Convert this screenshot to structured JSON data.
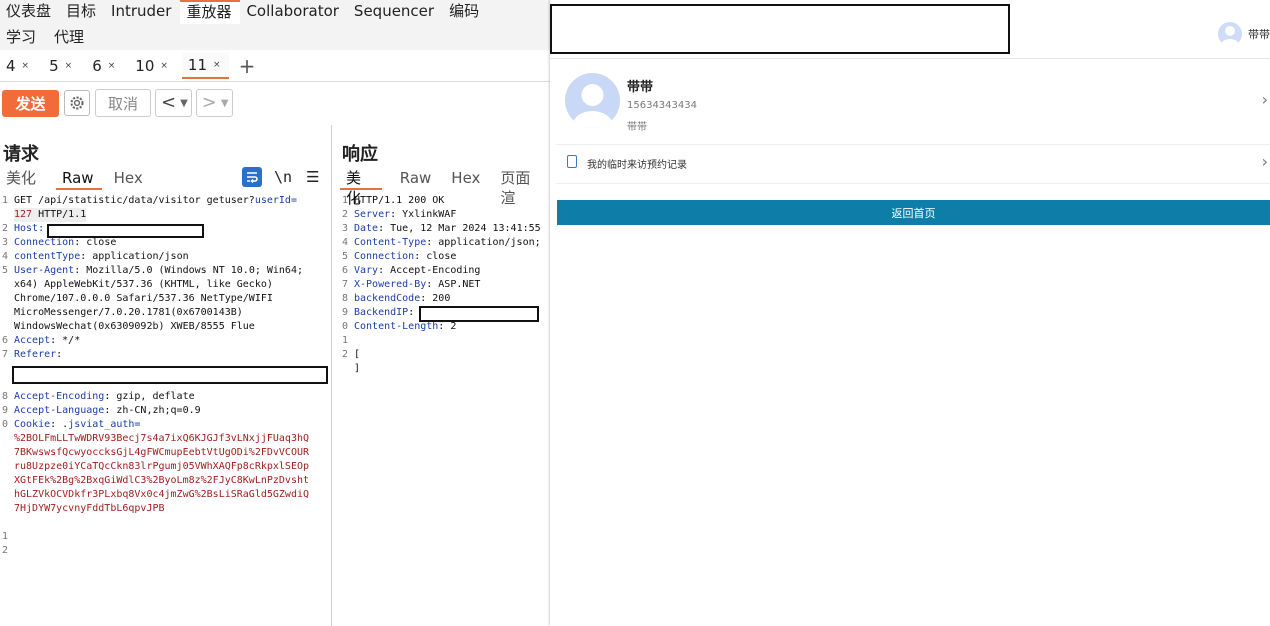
{
  "nav": {
    "items": [
      "仪表盘",
      "目标",
      "Intruder",
      "重放器",
      "Collaborator",
      "Sequencer",
      "编码"
    ],
    "active_index": 3,
    "sub_items": [
      "学习",
      "代理"
    ]
  },
  "tabs": {
    "items": [
      "4",
      "5",
      "6",
      "10",
      "11"
    ],
    "close": "×",
    "add": "+",
    "active_index": 4
  },
  "toolbar": {
    "send": "发送",
    "cancel": "取消",
    "back": "<",
    "forward": ">",
    "dropdown": "▼"
  },
  "request": {
    "title": "请求",
    "views": [
      "美化",
      "Raw",
      "Hex"
    ],
    "active_view": 1,
    "newline_toggle": "\\n",
    "menu": "☰",
    "lines": [
      {
        "n": "1",
        "segs": [
          [
            "t",
            "GET /api/statistic/data/visitor getuser?"
          ],
          [
            "k",
            "userId="
          ]
        ]
      },
      {
        "n": "",
        "segs": [
          [
            "r",
            "127"
          ],
          [
            "t",
            " HTTP/1.1"
          ]
        ]
      },
      {
        "n": "2",
        "segs": [
          [
            "k",
            "Host:"
          ]
        ]
      },
      {
        "n": "3",
        "segs": [
          [
            "k",
            "Connection"
          ],
          [
            "t",
            ": close"
          ]
        ]
      },
      {
        "n": "4",
        "segs": [
          [
            "k",
            "contentType"
          ],
          [
            "t",
            ": application/json"
          ]
        ]
      },
      {
        "n": "5",
        "segs": [
          [
            "k",
            "User-Agent"
          ],
          [
            "t",
            ": Mozilla/5.0 (Windows NT 10.0; Win64;"
          ]
        ]
      },
      {
        "n": "",
        "segs": [
          [
            "t",
            "x64) AppleWebKit/537.36 (KHTML, like Gecko)"
          ]
        ]
      },
      {
        "n": "",
        "segs": [
          [
            "t",
            "Chrome/107.0.0.0 Safari/537.36 NetType/WIFI"
          ]
        ]
      },
      {
        "n": "",
        "segs": [
          [
            "t",
            "MicroMessenger/7.0.20.1781(0x6700143B)"
          ]
        ]
      },
      {
        "n": "",
        "segs": [
          [
            "t",
            "WindowsWechat(0x6309092b) XWEB/8555 Flue"
          ]
        ]
      },
      {
        "n": "6",
        "segs": [
          [
            "k",
            "Accept"
          ],
          [
            "t",
            ": */*"
          ]
        ]
      },
      {
        "n": "7",
        "segs": [
          [
            "k",
            "Referer"
          ],
          [
            "t",
            ":"
          ]
        ]
      },
      {
        "n": "",
        "segs": [
          [
            "t",
            ""
          ]
        ]
      },
      {
        "n": "",
        "segs": [
          [
            "t",
            ""
          ]
        ]
      },
      {
        "n": "8",
        "segs": [
          [
            "k",
            "Accept-Encoding"
          ],
          [
            "t",
            ": gzip, deflate"
          ]
        ]
      },
      {
        "n": "9",
        "segs": [
          [
            "k",
            "Accept-Language"
          ],
          [
            "t",
            ": zh-CN,zh;q=0.9"
          ]
        ]
      },
      {
        "n": "0",
        "segs": [
          [
            "k",
            "Cookie"
          ],
          [
            "t",
            ": ."
          ],
          [
            "k",
            "jsviat_auth="
          ]
        ]
      },
      {
        "n": "",
        "segs": [
          [
            "r",
            "%2BOLFmLLTwWDRV93Becj7s4a7ixQ6KJGJf3vLNxjjFUaq3hQ"
          ]
        ]
      },
      {
        "n": "",
        "segs": [
          [
            "r",
            "7BKwswsfQcwyoccksGjL4gFWCmupEebtVtUgODi%2FDvVCOUR"
          ]
        ]
      },
      {
        "n": "",
        "segs": [
          [
            "r",
            "ru8Uzpze0iYCaTQcCkn83lrPgumj05VWhXAQFp8cRkpxlSEOp"
          ]
        ]
      },
      {
        "n": "",
        "segs": [
          [
            "r",
            "XGtFEk%2Bg%2BxqGiWdlC3%2ByoLm8z%2FJyC8KwLnPzDvsht"
          ]
        ]
      },
      {
        "n": "",
        "segs": [
          [
            "r",
            "hGLZVkOCVDkfr3PLxbq8Vx0c4jmZwG%2BsLiSRaGld5GZwdiQ"
          ]
        ]
      },
      {
        "n": "",
        "segs": [
          [
            "r",
            "7HjDYW7ycvnyFddTbL6qpvJPB"
          ]
        ]
      },
      {
        "n": "",
        "segs": [
          [
            "t",
            ""
          ]
        ]
      },
      {
        "n": "1",
        "segs": [
          [
            "t",
            ""
          ]
        ]
      },
      {
        "n": "2",
        "segs": [
          [
            "t",
            ""
          ]
        ]
      }
    ]
  },
  "response": {
    "title": "响应",
    "views": [
      "美化",
      "Raw",
      "Hex",
      "页面渲"
    ],
    "active_view": 0,
    "lines": [
      {
        "n": "1",
        "segs": [
          [
            "t",
            "HTTP/1.1 200 OK"
          ]
        ]
      },
      {
        "n": "2",
        "segs": [
          [
            "k",
            "Server"
          ],
          [
            "t",
            ": YxlinkWAF"
          ]
        ]
      },
      {
        "n": "3",
        "segs": [
          [
            "k",
            "Date"
          ],
          [
            "t",
            ": Tue, 12 Mar 2024 13:41:55"
          ]
        ]
      },
      {
        "n": "4",
        "segs": [
          [
            "k",
            "Content-Type"
          ],
          [
            "t",
            ": application/json;"
          ]
        ]
      },
      {
        "n": "5",
        "segs": [
          [
            "k",
            "Connection"
          ],
          [
            "t",
            ": close"
          ]
        ]
      },
      {
        "n": "6",
        "segs": [
          [
            "k",
            "Vary"
          ],
          [
            "t",
            ": Accept-Encoding"
          ]
        ]
      },
      {
        "n": "7",
        "segs": [
          [
            "k",
            "X-Powered-By"
          ],
          [
            "t",
            ": ASP.NET"
          ]
        ]
      },
      {
        "n": "8",
        "segs": [
          [
            "k",
            "backendCode"
          ],
          [
            "t",
            ": 200"
          ]
        ]
      },
      {
        "n": "9",
        "segs": [
          [
            "k",
            "BackendIP"
          ],
          [
            "t",
            ":"
          ]
        ]
      },
      {
        "n": "0",
        "segs": [
          [
            "k",
            "Content-Length"
          ],
          [
            "t",
            ": 2"
          ]
        ]
      },
      {
        "n": "1",
        "segs": [
          [
            "t",
            ""
          ]
        ]
      },
      {
        "n": "2",
        "segs": [
          [
            "t",
            "["
          ]
        ]
      },
      {
        "n": "",
        "segs": [
          [
            "t",
            "]"
          ]
        ]
      }
    ]
  },
  "wechat": {
    "header_user": "带带",
    "profile": {
      "name": "带带",
      "phone": "15634343434",
      "nickname": "带带"
    },
    "record_label": "我的临时来访预约记录",
    "chevron": "›",
    "home_button": "返回首页"
  },
  "colors": {
    "accent": "#e8723c",
    "send": "#f26b3a",
    "key": "#1b3ea8",
    "value_red": "#a11f1f",
    "home_button": "#0e7ea8"
  }
}
